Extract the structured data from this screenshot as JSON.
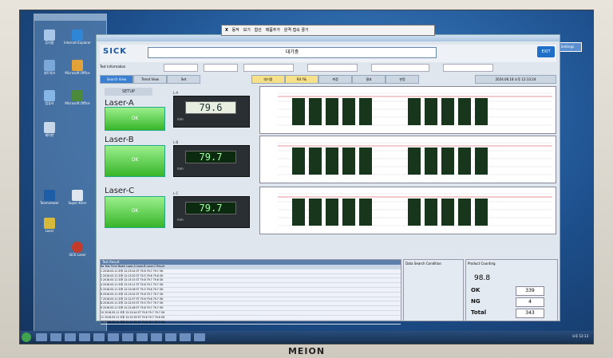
{
  "app": {
    "logo": "SICK",
    "title_field": "대기중",
    "ok_button": "EXIT",
    "info_label": "Test Information",
    "tabs": [
      "Search View",
      "Trend View",
      "Set"
    ],
    "status_tabs": [
      "대기중",
      "R4 Y&",
      "측정",
      "결과",
      "판정",
      "2024.06.18 오후 12:13:24"
    ],
    "setup_button": "SETUP"
  },
  "lasers": [
    {
      "name": "Laser-A",
      "status": "OK",
      "value": "79.6",
      "meter_label": "L-A"
    },
    {
      "name": "Laser-B",
      "status": "OK",
      "value": "79.7",
      "meter_label": "L-B"
    },
    {
      "name": "Laser-C",
      "status": "OK",
      "value": "79.7",
      "meter_label": "L-C"
    }
  ],
  "table": {
    "title": "Test Result",
    "columns": [
      "No",
      "Test Time",
      "Model",
      "Laser-A",
      "Laser-B",
      "Laser-C",
      "Result"
    ],
    "rows": [
      [
        "1",
        "2016.05.11 오후 12:13:24",
        "ST",
        "79.6",
        "79.7",
        "79.7",
        "OK"
      ],
      [
        "2",
        "2016.05.11 오후 12:13:20",
        "ST",
        "79.5",
        "79.6",
        "79.6",
        "OK"
      ],
      [
        "3",
        "2016.05.11 오후 12:13:15",
        "ST",
        "79.6",
        "79.7",
        "79.6",
        "OK"
      ],
      [
        "4",
        "2016.05.11 오후 12:13:11",
        "ST",
        "79.6",
        "79.7",
        "79.7",
        "OK"
      ],
      [
        "5",
        "2016.05.11 오후 12:13:06",
        "ST",
        "79.5",
        "79.6",
        "79.7",
        "OK"
      ],
      [
        "6",
        "2016.05.11 오후 12:13:02",
        "ST",
        "79.6",
        "79.7",
        "79.7",
        "OK"
      ],
      [
        "7",
        "2016.05.11 오후 12:12:57",
        "ST",
        "79.6",
        "79.6",
        "79.7",
        "OK"
      ],
      [
        "8",
        "2016.05.11 오후 12:12:53",
        "ST",
        "79.5",
        "79.7",
        "79.7",
        "OK"
      ],
      [
        "9",
        "2016.05.11 오후 12:12:48",
        "ST",
        "79.6",
        "79.7",
        "79.7",
        "OK"
      ],
      [
        "10",
        "2016.05.11 오후 12:12:44",
        "ST",
        "79.6",
        "79.7",
        "79.7",
        "OK"
      ],
      [
        "11",
        "2016.05.11 오후 12:12:39",
        "ST",
        "79.6",
        "79.7",
        "79.6",
        "OK"
      ],
      [
        "12",
        "2016.05.11 오후 12:12:35",
        "ST",
        "79.6",
        "79.7",
        "79.7",
        "OK"
      ]
    ]
  },
  "condition": {
    "title": "Data Search Condition"
  },
  "counting": {
    "title": "Product Counting",
    "rate": "98.8",
    "ok_label": "OK",
    "ok_value": "339",
    "ng_label": "NG",
    "ng_value": "4",
    "total_label": "Total",
    "total_value": "343"
  },
  "floating_toolbar": {
    "items": [
      "X",
      "동작",
      "보기",
      "합산",
      "제품추가",
      "원격 접속 끊기"
    ]
  },
  "side_button": "Settings",
  "desktop_icons": [
    "휴지통",
    "Internet Explorer",
    "네트워크",
    "Microsoft Office",
    "컴퓨터",
    "Microsoft Office",
    "제어판",
    "Teamviewer",
    "Super Killer",
    "Laser",
    "SICK Laser"
  ],
  "taskbar": {
    "clock": "오후 12:13"
  },
  "monitor_brand": "MEION",
  "colors": {
    "ok_green": "#37b52a",
    "bar_green": "#17361b",
    "accent": "#1f6fc9"
  }
}
